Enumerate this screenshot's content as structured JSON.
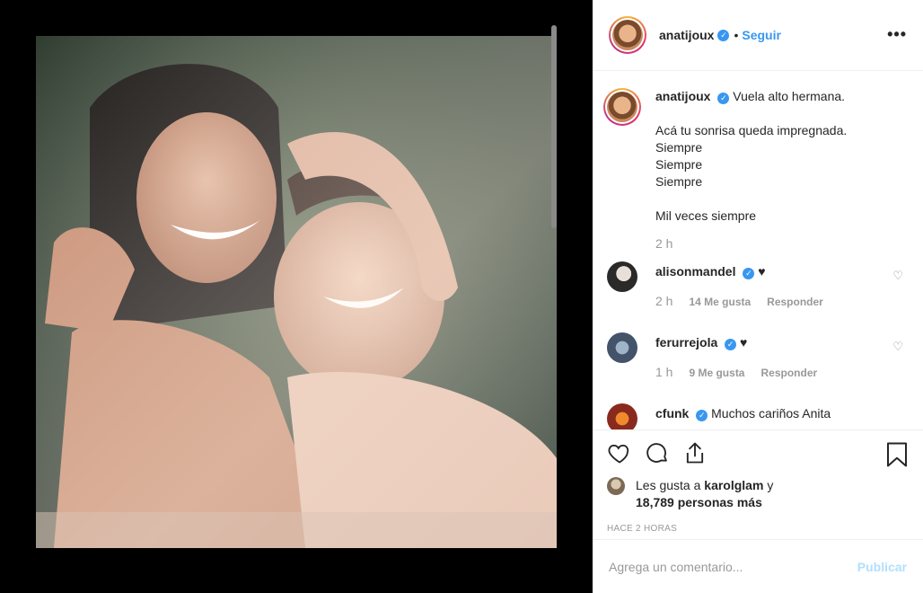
{
  "post": {
    "author": "anatijoux",
    "follow_label": "Seguir",
    "separator": "•",
    "more_label": "•••",
    "verified_mark": "✓"
  },
  "caption": {
    "user": "anatijoux",
    "lines": [
      "Vuela alto hermana.",
      "",
      "Acá tu sonrisa queda impregnada.",
      "Siempre",
      "Siempre",
      "Siempre",
      "",
      "Mil veces siempre"
    ],
    "time": "2 h"
  },
  "comments": [
    {
      "user": "alisonmandel",
      "text": "♥",
      "time": "2 h",
      "likes": "14 Me gusta",
      "reply": "Responder"
    },
    {
      "user": "ferurrejola",
      "text": "♥",
      "time": "1 h",
      "likes": "9 Me gusta",
      "reply": "Responder"
    },
    {
      "user": "cfunk",
      "text": "Muchos cariños Anita"
    }
  ],
  "likes_line": {
    "prefix": "Les gusta a",
    "user": "karolglam",
    "suffix": "y",
    "rest": "18,789 personas más"
  },
  "time_ago": "HACE 2 HORAS",
  "add_comment": {
    "placeholder": "Agrega un comentario...",
    "publish": "Publicar"
  },
  "colors": {
    "accent": "#3897f0",
    "publish_disabled": "#b2dffc",
    "muted": "#999999"
  }
}
